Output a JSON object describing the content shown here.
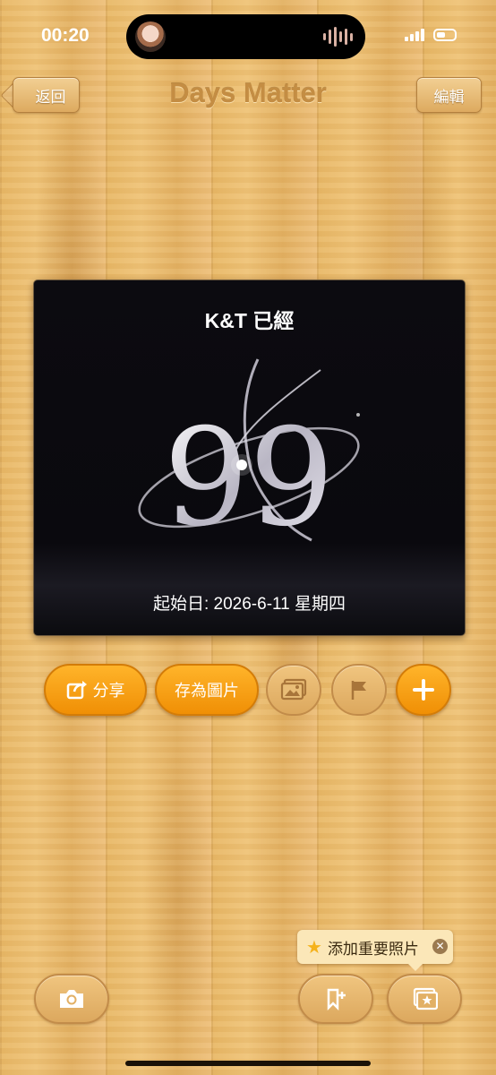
{
  "status_bar": {
    "time": "00:20"
  },
  "nav": {
    "back_label": "返回",
    "title": "Days Matter",
    "edit_label": "編輯"
  },
  "card": {
    "title": "K&T 已經",
    "days": "99",
    "start_label": "起始日: 2026-6-11 星期四"
  },
  "actions": {
    "share_label": "分享",
    "save_image_label": "存為圖片",
    "icons": [
      "share-icon",
      "photo-icon",
      "flag-icon",
      "plus-icon"
    ]
  },
  "bottom": {
    "tooltip": "添加重要照片",
    "icons": [
      "camera-icon",
      "bookmark-add-icon",
      "gallery-icon"
    ]
  },
  "colors": {
    "accent": "#f7a316",
    "wood": "#e8b866",
    "card_bg": "#0b0a0f"
  }
}
